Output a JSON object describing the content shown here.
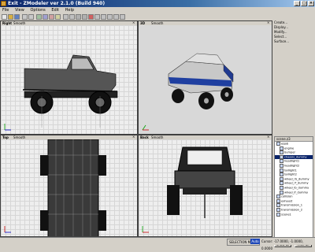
{
  "window": {
    "title": "Exit - ZModeler ver 2.1.0 (Build 940)"
  },
  "menu": [
    "File",
    "View",
    "Options",
    "Edit",
    "Help"
  ],
  "viewports": {
    "top_left": {
      "name": "Right",
      "mode": "Smooth"
    },
    "top_right": {
      "name": "3D",
      "mode": "Smooth"
    },
    "bottom_left": {
      "name": "Top",
      "mode": "Smooth"
    },
    "bottom_right": {
      "name": "Back",
      "mode": "Smooth"
    }
  },
  "commands": [
    "Create...",
    "Display...",
    "Modify...",
    "Select...",
    "Surface..."
  ],
  "scene": {
    "header": "scene.z3",
    "rows": [
      {
        "label": "eqab",
        "checked": true,
        "selected": false,
        "indent": 0
      },
      {
        "label": "engine",
        "checked": true,
        "selected": false,
        "indent": 1
      },
      {
        "label": "bumper",
        "checked": true,
        "selected": false,
        "indent": 1
      },
      {
        "label": "chassis_dummy",
        "checked": true,
        "selected": true,
        "indent": 1
      },
      {
        "label": "headlight1",
        "checked": true,
        "selected": false,
        "indent": 1
      },
      {
        "label": "headlight2",
        "checked": true,
        "selected": false,
        "indent": 1
      },
      {
        "label": "taillight1",
        "checked": true,
        "selected": false,
        "indent": 1
      },
      {
        "label": "taillight2",
        "checked": true,
        "selected": false,
        "indent": 1
      },
      {
        "label": "wheel_rb_dummy",
        "checked": true,
        "selected": false,
        "indent": 1
      },
      {
        "label": "wheel_rf_dummy",
        "checked": true,
        "selected": false,
        "indent": 1
      },
      {
        "label": "wheel_lb_dummy",
        "checked": true,
        "selected": false,
        "indent": 1
      },
      {
        "label": "wheel_lf_dummy",
        "checked": true,
        "selected": false,
        "indent": 1
      },
      {
        "label": "collision",
        "checked": true,
        "selected": false,
        "indent": 0
      },
      {
        "label": "exhaust",
        "checked": true,
        "selected": false,
        "indent": 0
      },
      {
        "label": "transmission_1",
        "checked": true,
        "selected": false,
        "indent": 0
      },
      {
        "label": "transmission_2",
        "checked": true,
        "selected": false,
        "indent": 0
      },
      {
        "label": "scene1",
        "checked": true,
        "selected": false,
        "indent": 0
      }
    ]
  },
  "buttons": {
    "show_all": "Show all",
    "hide_all": "Hide all"
  },
  "status": {
    "selection": "SELECTION MODE",
    "badge": "Auto",
    "coords": "Cursor: -17.0000, -1.0000, 0.0000"
  },
  "colors": {
    "accent": "#0a246a",
    "truck_body": "#1f3fa0"
  }
}
